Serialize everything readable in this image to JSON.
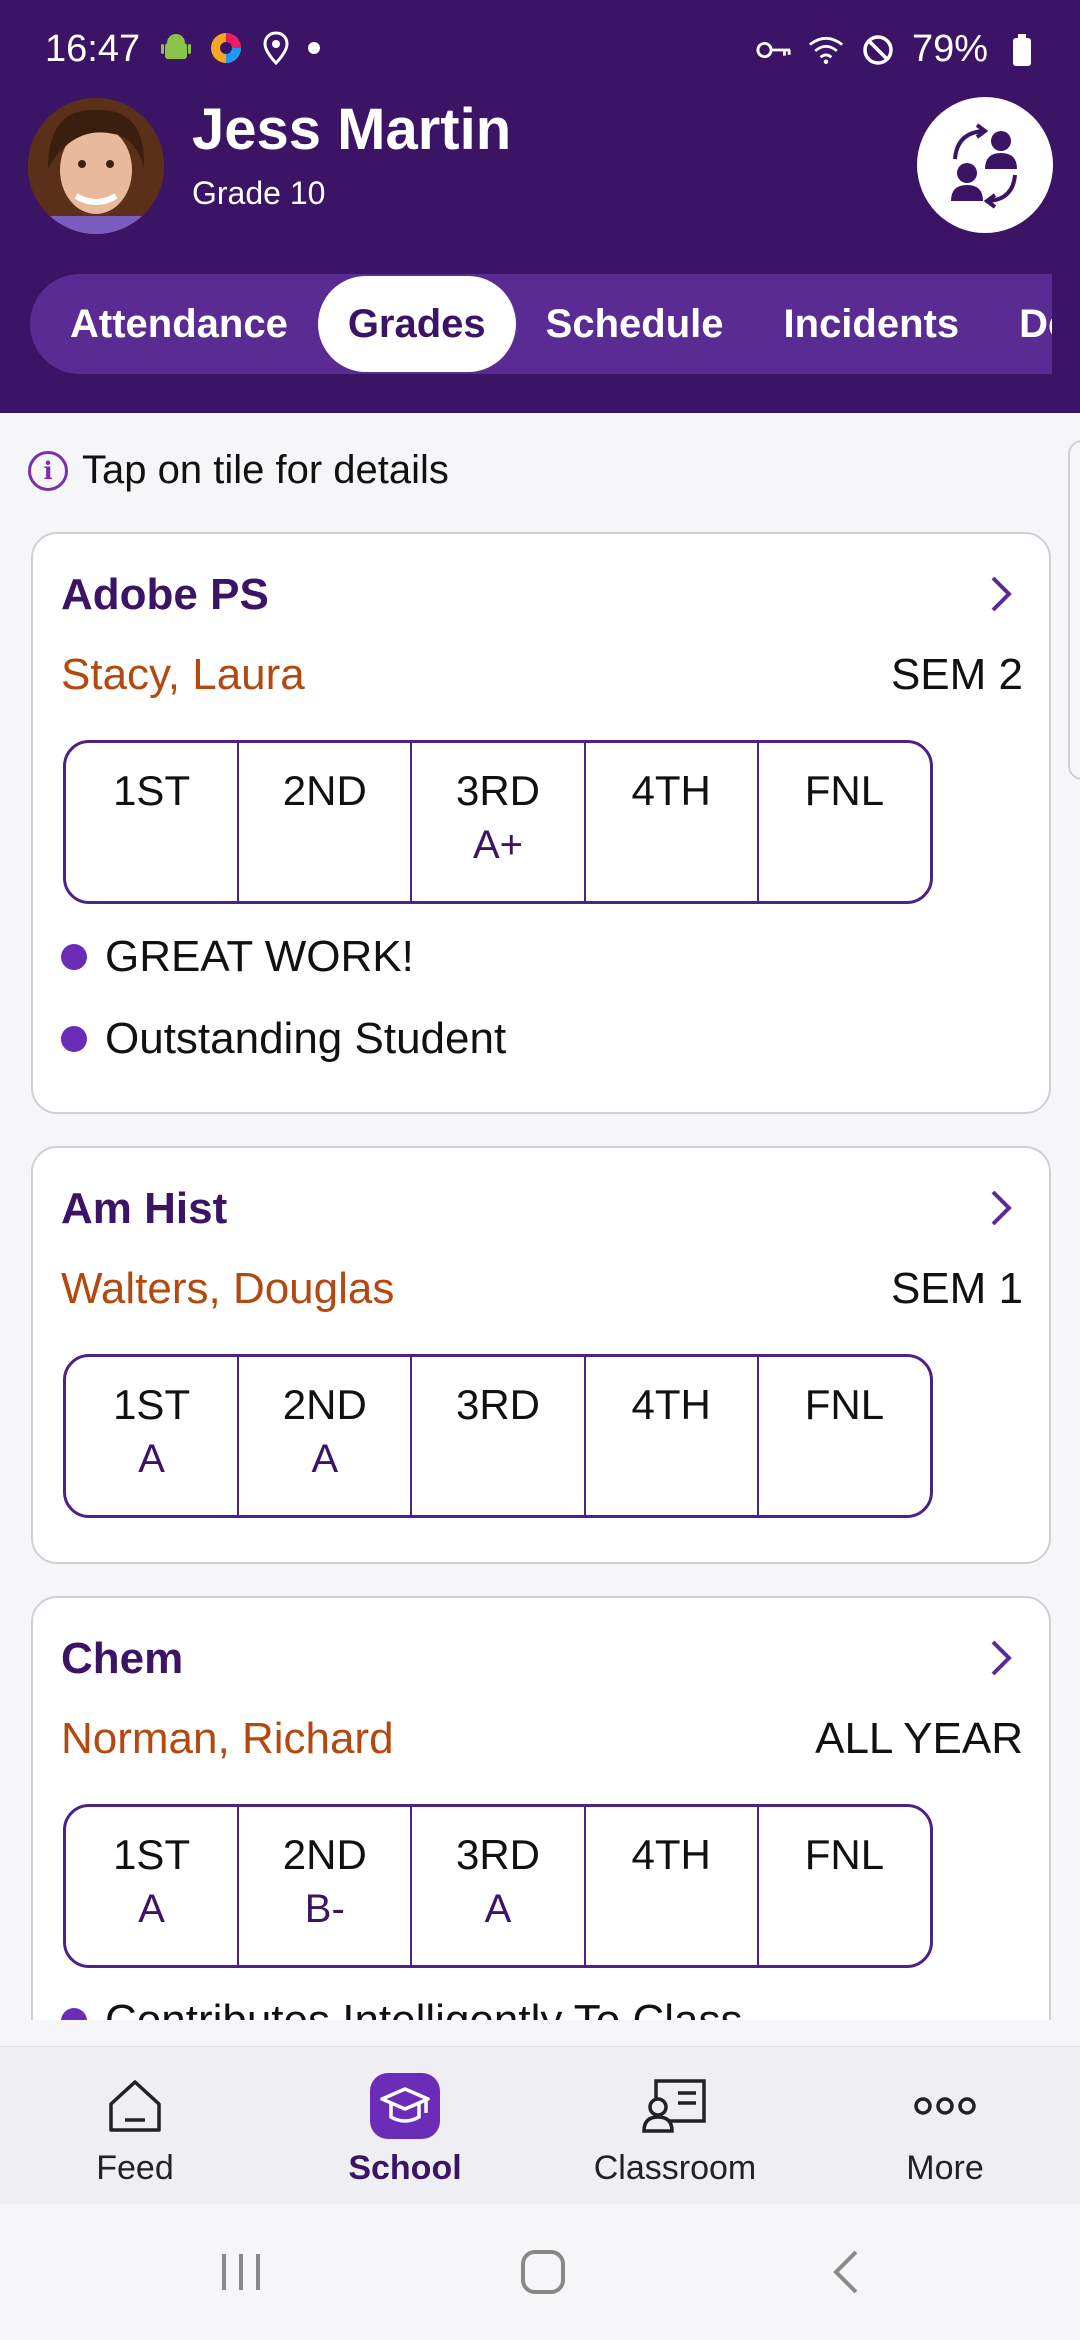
{
  "status": {
    "time": "16:47",
    "battery": "79%"
  },
  "student": {
    "name": "Jess Martin",
    "grade": "Grade 10"
  },
  "tabs": [
    "Attendance",
    "Grades",
    "Schedule",
    "Incidents",
    "De"
  ],
  "hint": "Tap on tile for details",
  "courses": [
    {
      "course": "Adobe PS",
      "teacher": "Stacy, Laura",
      "term": "SEM 2",
      "labels": [
        "1ST",
        "2ND",
        "3RD",
        "4TH",
        "FNL"
      ],
      "values": [
        "",
        "",
        "A+",
        "",
        ""
      ],
      "comments": [
        "GREAT WORK!",
        "Outstanding Student"
      ]
    },
    {
      "course": "Am Hist",
      "teacher": "Walters, Douglas",
      "term": "SEM 1",
      "labels": [
        "1ST",
        "2ND",
        "3RD",
        "4TH",
        "FNL"
      ],
      "values": [
        "A",
        "A",
        "",
        "",
        ""
      ],
      "comments": []
    },
    {
      "course": "Chem",
      "teacher": "Norman, Richard",
      "term": "ALL YEAR",
      "labels": [
        "1ST",
        "2ND",
        "3RD",
        "4TH",
        "FNL"
      ],
      "values": [
        "A",
        "B-",
        "A",
        "",
        ""
      ],
      "comments": [
        "Contributes Intelligently To Class"
      ]
    }
  ],
  "nav": {
    "feed": "Feed",
    "school": "School",
    "classroom": "Classroom",
    "more": "More"
  },
  "colors": {
    "header": "#3c1466",
    "tabbar": "#5a2c93",
    "teacher": "#b34810",
    "accent": "#6b2cb8"
  }
}
